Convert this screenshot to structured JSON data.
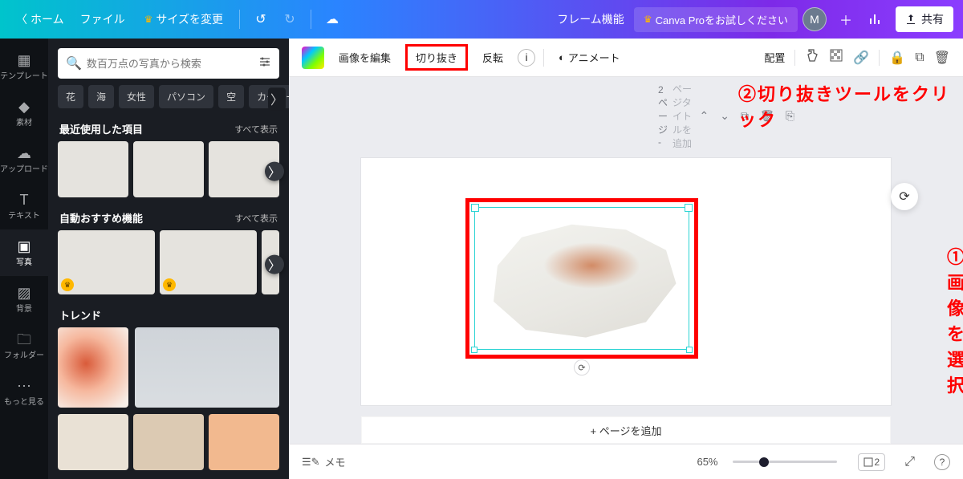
{
  "topbar": {
    "home": "ホーム",
    "file": "ファイル",
    "resize": "サイズを変更",
    "project_name": "フレーム機能",
    "pro_cta": "Canva Proをお試しください",
    "avatar_initial": "M",
    "share": "共有"
  },
  "rail": {
    "template": "テンプレート",
    "elements": "素材",
    "upload": "アップロード",
    "text": "テキスト",
    "photos": "写真",
    "background": "背景",
    "folder": "フォルダー",
    "more": "もっと見る"
  },
  "panel": {
    "search_placeholder": "数百万点の写真から検索",
    "chips": [
      "花",
      "海",
      "女性",
      "パソコン",
      "空",
      "カーネー"
    ],
    "recent": {
      "title": "最近使用した項目",
      "more": "すべて表示"
    },
    "auto": {
      "title": "自動おすすめ機能",
      "more": "すべて表示"
    },
    "trend": {
      "title": "トレンド"
    }
  },
  "ctbar": {
    "edit_image": "画像を編集",
    "crop": "切り抜き",
    "flip": "反転",
    "animate": "アニメート",
    "arrange": "配置"
  },
  "instructions": {
    "step1": "①画像を選択",
    "step2": "②切り抜きツールをクリック"
  },
  "page": {
    "label_prefix": "2ページ - ",
    "label_placeholder": "ページタイトルを追加",
    "add_page": "+ ページを追加"
  },
  "footer": {
    "memo": "メモ",
    "zoom": "65%",
    "page_indicator": "2"
  }
}
